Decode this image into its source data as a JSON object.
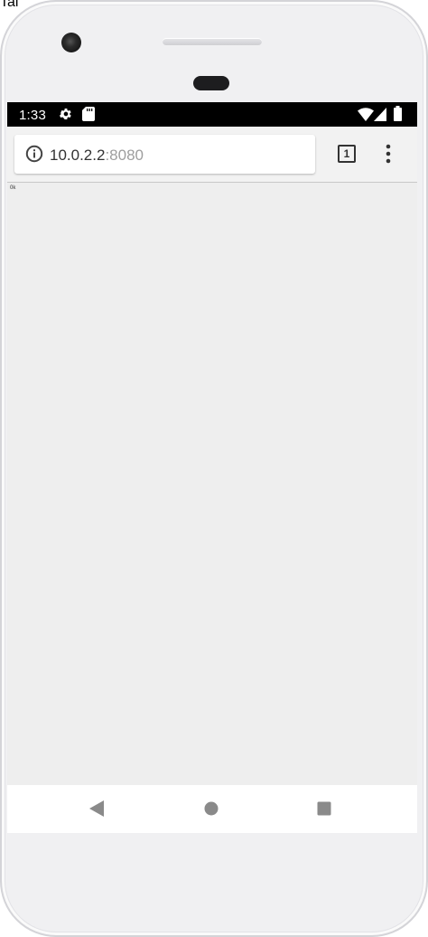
{
  "page_top_text": "Tal",
  "status_bar": {
    "time": "1:33",
    "left_icons": [
      "settings-gear-icon",
      "sd-card-icon"
    ],
    "right_icons": [
      "wifi-icon",
      "cellular-signal-icon",
      "battery-icon"
    ]
  },
  "browser": {
    "url_host": "10.0.2.2",
    "url_port": ":8080",
    "tab_count": "1",
    "icons": [
      "info-icon",
      "overflow-menu-icon"
    ]
  },
  "page": {
    "text": "0k"
  },
  "nav_bar": {
    "icons": [
      "back-triangle-icon",
      "home-circle-icon",
      "recents-square-icon"
    ]
  },
  "colors": {
    "status_bar_bg": "#000000",
    "toolbar_bg": "#f2f2f2",
    "page_bg": "#eeeeee",
    "nav_icon": "#8a8a8a"
  }
}
